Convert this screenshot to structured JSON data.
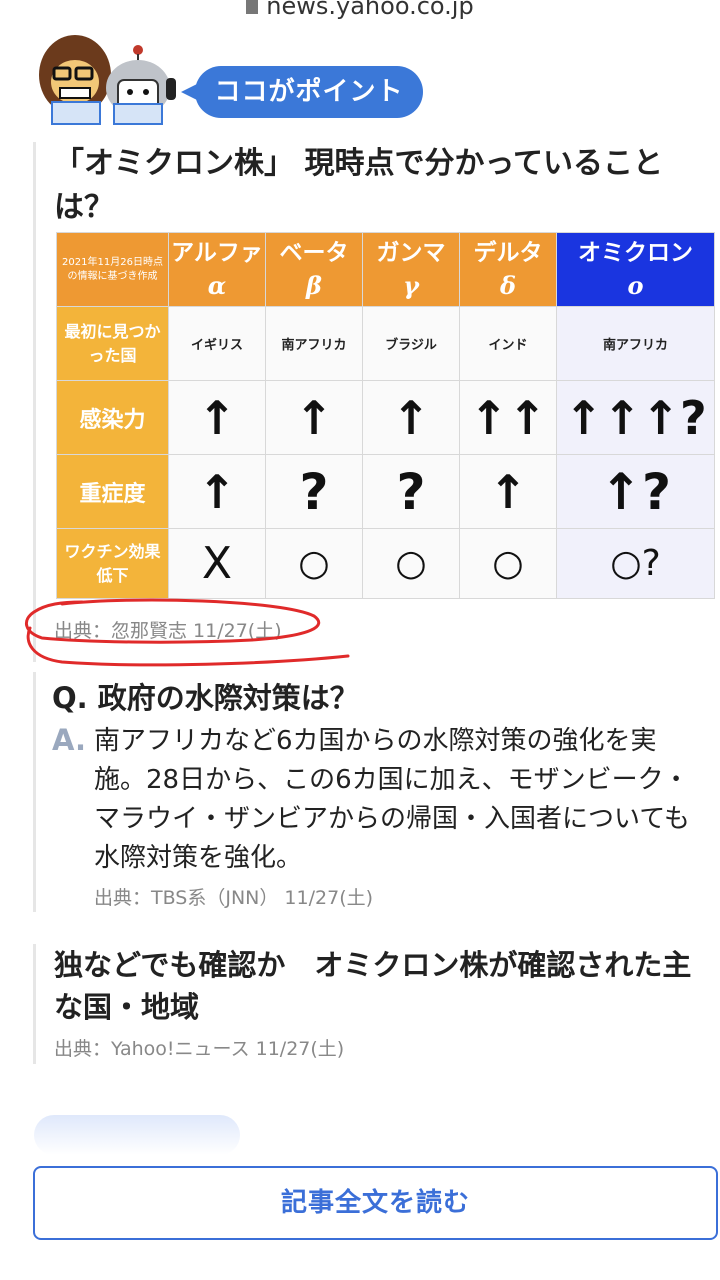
{
  "browser": {
    "url": "news.yahoo.co.jp"
  },
  "point_badge": {
    "label": "ココがポイント"
  },
  "section": {
    "title": "「オミクロン株」 現時点で分かっていることは？",
    "table": {
      "corner_note": "2021年11月26日時点の情報に基づき作成",
      "variants": [
        {
          "name": "アルファ",
          "greek": "α"
        },
        {
          "name": "ベータ",
          "greek": "β"
        },
        {
          "name": "ガンマ",
          "greek": "γ"
        },
        {
          "name": "デルタ",
          "greek": "δ"
        },
        {
          "name": "オミクロン",
          "greek": "ο"
        }
      ],
      "rows": [
        {
          "label": "最初に見つかった国",
          "cells": [
            "イギリス",
            "南アフリカ",
            "ブラジル",
            "インド",
            "南アフリカ"
          ]
        },
        {
          "label": "感染力",
          "cells": [
            "↑",
            "↑",
            "↑",
            "↑↑",
            "↑↑↑?"
          ]
        },
        {
          "label": "重症度",
          "cells": [
            "↑",
            "?",
            "?",
            "↑",
            "↑?"
          ]
        },
        {
          "label": "ワクチン効果低下",
          "cells": [
            "X",
            "○",
            "○",
            "○",
            "○?"
          ]
        }
      ]
    },
    "source": "出典：忽那賢志 11/27(土)"
  },
  "qa": {
    "q_prefix": "Q.",
    "question": "政府の水際対策は？",
    "a_prefix": "A.",
    "answer": "南アフリカなど6カ国からの水際対策の強化を実施。28日から、この6カ国に加え、モザンビーク・マラウイ・ザンビアからの帰国・入国者についても水際対策を強化。",
    "source": "出典：TBS系（JNN） 11/27(土)"
  },
  "related": {
    "title": "独などでも確認か　オミクロン株が確認された主な国・地域",
    "source": "出典：Yahoo!ニュース 11/27(土)"
  },
  "read_button": {
    "label": "記事全文を読む"
  },
  "colors": {
    "accent": "#3b78d8",
    "header_orange": "#ee9933",
    "omicron_blue": "#1a35e0",
    "row_header": "#f3b43a",
    "annotation_red": "#e02a2a"
  }
}
